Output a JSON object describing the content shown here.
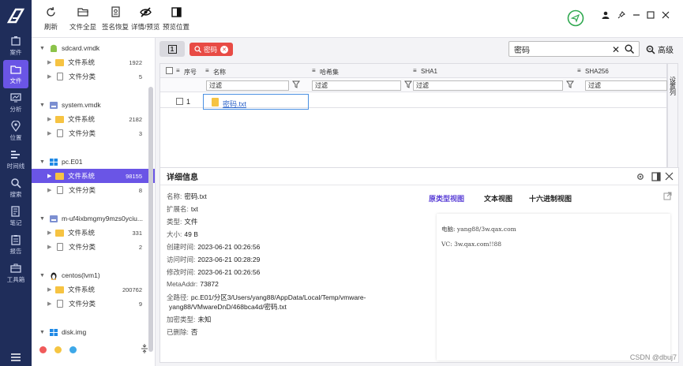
{
  "nav": {
    "items": [
      {
        "label": "案件",
        "icon": "case-icon"
      },
      {
        "label": "文件",
        "icon": "folder-icon"
      },
      {
        "label": "分析",
        "icon": "analysis-icon"
      },
      {
        "label": "位置",
        "icon": "location-icon"
      },
      {
        "label": "时间线",
        "icon": "timeline-icon"
      },
      {
        "label": "搜索",
        "icon": "search-icon"
      },
      {
        "label": "笔记",
        "icon": "note-icon"
      },
      {
        "label": "报告",
        "icon": "report-icon"
      },
      {
        "label": "工具箱",
        "icon": "toolbox-icon"
      }
    ],
    "active_color": "#6a55e6"
  },
  "toolbar": {
    "refresh": "刷新",
    "expand_all": "文件全显",
    "sign_restore": "签名恢复",
    "detail_preview": "详情/预览",
    "preview_position": "预览位置"
  },
  "tree": [
    {
      "device": "sdcard.vmdk",
      "icon": "android-icon",
      "fs": "文件系统",
      "fs_count": "1922",
      "cls": "文件分类",
      "cls_count": "5"
    },
    {
      "device": "system.vmdk",
      "icon": "disk-icon",
      "fs": "文件系统",
      "fs_count": "2182",
      "cls": "文件分类",
      "cls_count": "3"
    },
    {
      "device": "pc.E01",
      "icon": "windows-icon",
      "fs": "文件系统",
      "fs_count": "98155",
      "cls": "文件分类",
      "cls_count": "8"
    },
    {
      "device": "m-uf4ixbmgmy9mzs0yciu...",
      "icon": "disk-icon",
      "fs": "文件系统",
      "fs_count": "331",
      "cls": "文件分类",
      "cls_count": "2"
    },
    {
      "device": "centos(lvm1)",
      "icon": "linux-icon",
      "fs": "文件系统",
      "fs_count": "200762",
      "cls": "文件分类",
      "cls_count": "9"
    },
    {
      "device": "disk.img",
      "icon": "windows-icon",
      "fs": "文件系统",
      "fs_count": "",
      "cls": "",
      "cls_count": ""
    }
  ],
  "tab": {
    "number": "1",
    "tag": "密码"
  },
  "search": {
    "value": "密码",
    "advanced": "高级"
  },
  "grid": {
    "columns": [
      "序号",
      "名称",
      "哈希集",
      "SHA1",
      "SHA256"
    ],
    "filter_placeholder": "过滤",
    "rows": [
      {
        "index": "1",
        "name": "密码.txt"
      }
    ],
    "side_label": "设置列"
  },
  "detail": {
    "title": "详细信息",
    "fields": [
      {
        "k": "名称:",
        "v": "密码.txt"
      },
      {
        "k": "扩展名:",
        "v": "txt"
      },
      {
        "k": "类型:",
        "v": "文件"
      },
      {
        "k": "大小:",
        "v": "49 B"
      },
      {
        "k": "创建时间:",
        "v": "2023-06-21 00:26:56"
      },
      {
        "k": "访问时间:",
        "v": "2023-06-21 00:28:29"
      },
      {
        "k": "修改时间:",
        "v": "2023-06-21 00:26:56"
      },
      {
        "k": "MetaAddr:",
        "v": "73872"
      },
      {
        "k": "全路径:",
        "v": "pc.E01/分区3/Users/yang88/AppData/Local/Temp/vmware-"
      },
      {
        "k": "",
        "v": "yang88/VMwareDnD/468bca4d/密码.txt"
      },
      {
        "k": "加密类型:",
        "v": "未知"
      },
      {
        "k": "已删除:",
        "v": "否"
      }
    ],
    "views": [
      "原类型视图",
      "文本视图",
      "十六进制视图"
    ],
    "view_active_color": "#5a3fd6",
    "preview_lines": [
      "电脑: yang88/3w.qax.com",
      "VC: 3w.qax.com!!88"
    ]
  },
  "watermark": "CSDN @dbuj7"
}
